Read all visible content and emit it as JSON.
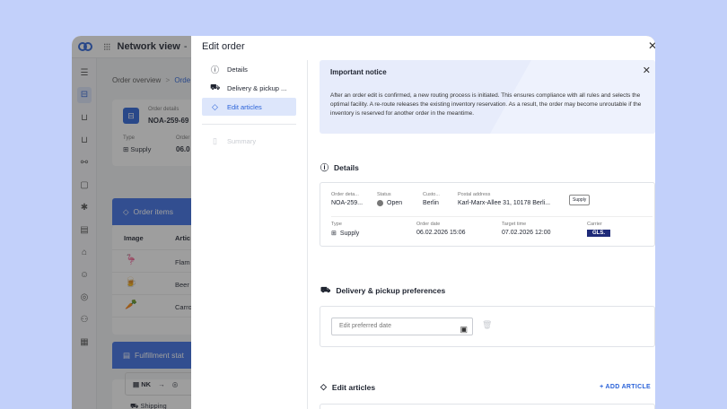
{
  "app": {
    "title": "Network view",
    "title_suffix": "-"
  },
  "background": {
    "breadcrumb": {
      "root": "Order overview",
      "separator": ">",
      "current": "Orde"
    },
    "order_card": {
      "label": "Order details",
      "number": "NOA-259-69",
      "type_label": "Type",
      "type_value": "Supply",
      "order_label": "Order",
      "order_value": "06.0"
    },
    "order_items": {
      "title": "Order items",
      "column_image": "Image",
      "column_article": "Artic",
      "rows": [
        "Flam",
        "Beer",
        "Carro"
      ]
    },
    "fulfillment": {
      "title": "Fulfillment stat",
      "badge": "NK",
      "arrow": "→",
      "shipping": "Shipping"
    }
  },
  "modal": {
    "title": "Edit order",
    "steps": [
      {
        "label": "Details",
        "icon": "info-icon",
        "state": "done"
      },
      {
        "label": "Delivery & pickup ...",
        "icon": "truck-icon",
        "state": "done"
      },
      {
        "label": "Edit articles",
        "icon": "tag-icon",
        "state": "active"
      },
      {
        "label": "Summary",
        "icon": "summary-icon",
        "state": "disabled"
      }
    ],
    "notice": {
      "title": "Important notice",
      "text": "After an order edit is confirmed, a new routing process is initiated. This ensures compliance with all rules and selects the optimal facility. A re-route releases the existing inventory reservation. As a result, the order may become unroutable if the inventory is reserved for another order in the meantime."
    },
    "details": {
      "title": "Details",
      "order_details_label": "Order deta...",
      "order_details_value": "NOA-259...",
      "status_label": "Status",
      "status_value": "Open",
      "customer_label": "Custo...",
      "customer_value": "Berlin",
      "postal_label": "Postal address",
      "postal_value": "Karl-Marx-Allee 31, 10178 Berli...",
      "chip": "Supply",
      "type_label": "Type",
      "type_value": "Supply",
      "order_date_label": "Order date",
      "order_date_value": "06.02.2026 15:06",
      "target_time_label": "Target time",
      "target_time_value": "07.02.2026 12:00",
      "carrier_label": "Carrier",
      "carrier_value": "GLS."
    },
    "delivery": {
      "title": "Delivery & pickup preferences",
      "date_placeholder": "Edit preferred date"
    },
    "articles": {
      "title": "Edit articles",
      "add_label": "+ ADD ARTICLE"
    }
  },
  "colors": {
    "accent": "#2b63d9",
    "page_bg": "#c2d0fa",
    "notice_bg": "#e7ecfb",
    "carrier_bg": "#1e2a78"
  }
}
